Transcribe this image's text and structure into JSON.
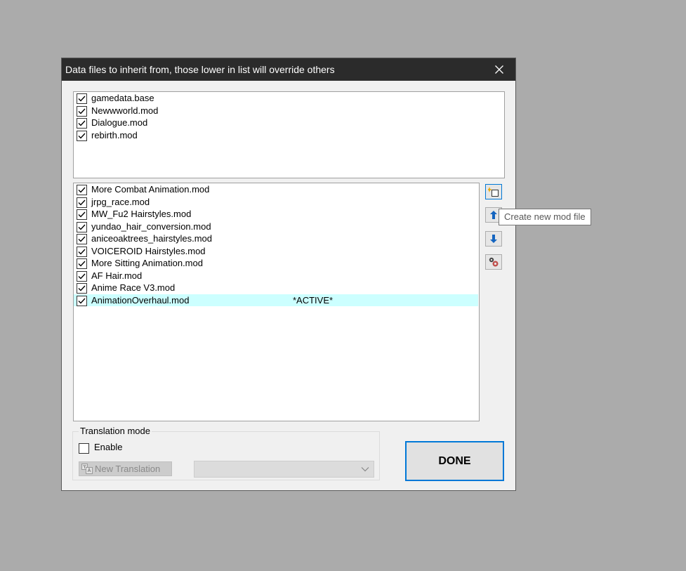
{
  "dialog": {
    "title": "Data files to inherit from, those lower in list will override others"
  },
  "base_files": [
    {
      "name": "gamedata.base",
      "checked": true
    },
    {
      "name": "Newwworld.mod",
      "checked": true
    },
    {
      "name": "Dialogue.mod",
      "checked": true
    },
    {
      "name": "rebirth.mod",
      "checked": true
    }
  ],
  "mod_files": [
    {
      "name": "More Combat Animation.mod",
      "checked": true
    },
    {
      "name": "jrpg_race.mod",
      "checked": true
    },
    {
      "name": "MW_Fu2 Hairstyles.mod",
      "checked": true
    },
    {
      "name": "yundao_hair_conversion.mod",
      "checked": true
    },
    {
      "name": "aniceoaktrees_hairstyles.mod",
      "checked": true
    },
    {
      "name": "VOICEROID Hairstyles.mod",
      "checked": true
    },
    {
      "name": "More Sitting Animation.mod",
      "checked": true
    },
    {
      "name": "AF Hair.mod",
      "checked": true
    },
    {
      "name": "Anime Race V3.mod",
      "checked": true
    },
    {
      "name": "AnimationOverhaul.mod",
      "checked": true,
      "status": "*ACTIVE*"
    }
  ],
  "side_buttons": [
    {
      "icon": "new-file-icon",
      "tooltip": "Create new mod file"
    },
    {
      "icon": "arrow-up-icon"
    },
    {
      "icon": "arrow-down-icon"
    },
    {
      "icon": "settings-gears-icon"
    }
  ],
  "tooltip": "Create new mod file",
  "translation": {
    "group_title": "Translation mode",
    "enable_label": "Enable",
    "enable_checked": false,
    "new_translation_label": "New Translation",
    "language_value": ""
  },
  "done_label": "DONE",
  "colors": {
    "active_row": "#ccffff",
    "accent": "#0078d7",
    "titlebar": "#2b2b2b",
    "desktop": "#ababab"
  }
}
